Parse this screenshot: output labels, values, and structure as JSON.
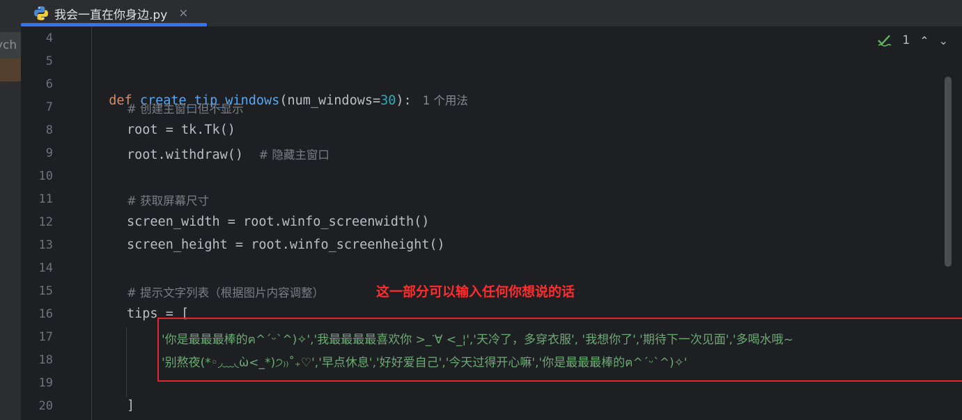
{
  "tab": {
    "title": "我会一直在你身边.py",
    "close": "×",
    "icon": "python-icon"
  },
  "sidebar": {
    "label": "ych"
  },
  "status": {
    "check_count": "1"
  },
  "annotation": "这一部分可以输入任何你想说的话",
  "code": {
    "line_numbers": [
      "4",
      "5",
      "6",
      "7",
      "8",
      "9",
      "10",
      "11",
      "12",
      "13",
      "14",
      "15",
      "16",
      "17",
      "18",
      "19",
      "20"
    ],
    "l6_def": "def",
    "l6_fn": "create_tip_windows",
    "l6_open": "(num_windows=",
    "l6_num": "30",
    "l6_close": "):",
    "l6_hint": "1 个用法",
    "l7": "# 创建主窗口但不显示",
    "l8": "root = tk.Tk()",
    "l9_code": "root.withdraw()",
    "l9_comment": "# 隐藏主窗口",
    "l11": "# 获取屏幕尺寸",
    "l12": "screen_width = root.winfo_screenwidth()",
    "l13": "screen_height = root.winfo_screenheight()",
    "l15": "# 提示文字列表（根据图片内容调整）",
    "l16": "tips = [",
    "l17": "'你是最最最棒的ฅ^ˊᵕˋ^)✧','我最最最最喜欢你 >_ᐝ∀ <_¦','天冷了，多穿衣服', '我想你了','期待下一次见面','多喝水哦~",
    "l18": "'别熬夜(*◦◞﹏◟ὼ<_*)੭₎₎˚₊♡','早点休息','好好爱自己','今天过得开心嘛','你是最最最棒的ฅ^ˊᵕˋ^)✧'",
    "l20": "]"
  }
}
